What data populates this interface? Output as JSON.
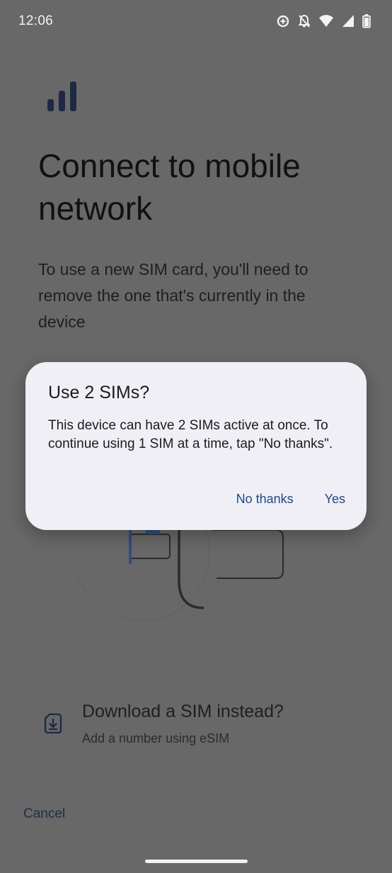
{
  "status_bar": {
    "time": "12:06",
    "icons": [
      "data-saver-icon",
      "notifications-off-icon",
      "wifi-icon",
      "cell-signal-icon",
      "battery-icon"
    ]
  },
  "page": {
    "header_icon": "signal-bars-icon",
    "title": "Connect to mobile network",
    "description": "To use a new SIM card, you'll need to remove the one that's currently in the device"
  },
  "esim_option": {
    "icon": "sim-download-icon",
    "title": "Download a SIM instead?",
    "subtitle": "Add a number using eSIM"
  },
  "cancel_label": "Cancel",
  "dialog": {
    "title": "Use 2 SIMs?",
    "message": "This device can have 2 SIMs active at once. To continue using 1 SIM at a time, tap \"No thanks\".",
    "negative_label": "No thanks",
    "positive_label": "Yes"
  },
  "colors": {
    "scrim_background": "#686868",
    "dialog_surface": "#f0eff5",
    "dialog_button_text": "#1f4a82",
    "signal_icon": "#1e2a44"
  }
}
